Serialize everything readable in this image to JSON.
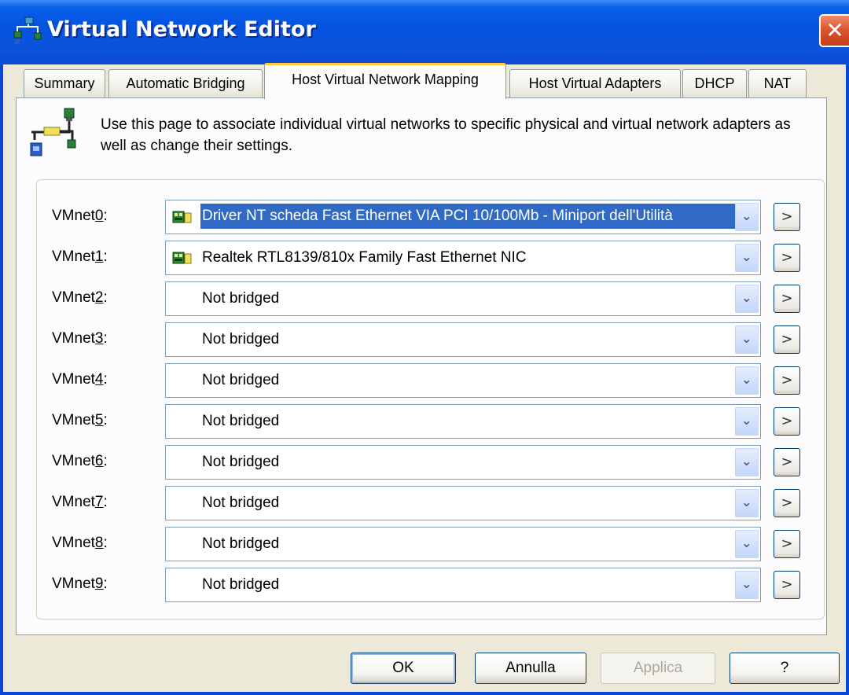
{
  "window": {
    "title": "Virtual Network Editor",
    "close_label": "✕"
  },
  "tabs": [
    {
      "label": "Summary"
    },
    {
      "label": "Automatic Bridging"
    },
    {
      "label": "Host Virtual Network Mapping"
    },
    {
      "label": "Host Virtual Adapters"
    },
    {
      "label": "DHCP"
    },
    {
      "label": "NAT"
    }
  ],
  "active_tab": "Host Virtual Network Mapping",
  "description": "Use this page to associate individual virtual networks to specific physical and virtual network adapters as well as change their settings.",
  "mappings": [
    {
      "prefix": "VMnet",
      "digit": "0",
      "value": "Driver NT scheda Fast Ethernet VIA PCI 10/100Mb - Miniport dell'Utilità",
      "icon": "network-card-icon",
      "selected": true
    },
    {
      "prefix": "VMnet",
      "digit": "1",
      "value": "Realtek RTL8139/810x Family Fast Ethernet NIC",
      "icon": "network-card-icon"
    },
    {
      "prefix": "VMnet",
      "digit": "2",
      "value": "Not bridged"
    },
    {
      "prefix": "VMnet",
      "digit": "3",
      "value": "Not bridged"
    },
    {
      "prefix": "VMnet",
      "digit": "4",
      "value": "Not bridged"
    },
    {
      "prefix": "VMnet",
      "digit": "5",
      "value": "Not bridged"
    },
    {
      "prefix": "VMnet",
      "digit": "6",
      "value": "Not bridged"
    },
    {
      "prefix": "VMnet",
      "digit": "7",
      "value": "Not bridged"
    },
    {
      "prefix": "VMnet",
      "digit": "8",
      "value": "Not bridged"
    },
    {
      "prefix": "VMnet",
      "digit": "9",
      "value": "Not bridged"
    }
  ],
  "label_suffix": ":",
  "settings_button_label": ">",
  "dropdown_glyph": "⌄",
  "buttons": {
    "ok": "OK",
    "cancel": "Annulla",
    "apply": "Applica",
    "help": "?"
  },
  "colors": {
    "titlebar": "#0553e0",
    "selection": "#316ac5",
    "active_tab_accent": "#ffc83c"
  }
}
